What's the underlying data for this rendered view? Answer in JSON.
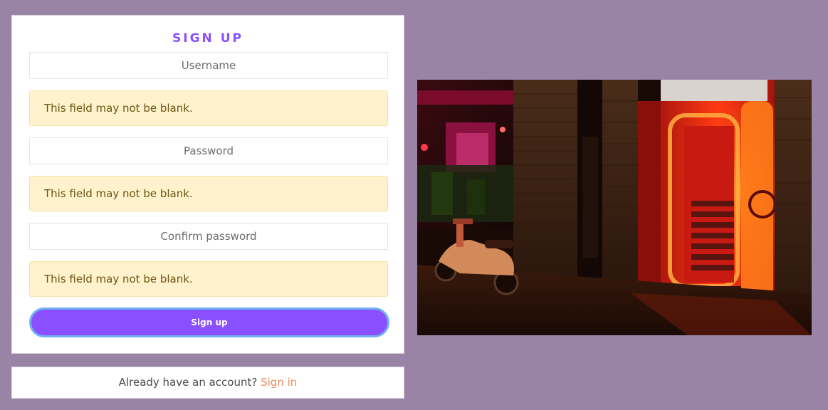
{
  "signup_form": {
    "title": "SIGN UP",
    "username_placeholder": "Username",
    "password_placeholder": "Password",
    "confirm_password_placeholder": "Confirm password",
    "username_error": "This field may not be blank.",
    "password_error": "This field may not be blank.",
    "confirm_password_error": "This field may not be blank.",
    "submit_label": "Sign up"
  },
  "signin_prompt": {
    "text": "Already have an account?",
    "link_label": "Sign in"
  },
  "photo": {
    "description": "Night street scene with a scooter parked beside a glowing red-lit doorway and stairway"
  },
  "colors": {
    "page_background": "#9a84a6",
    "accent_purple": "#8a4fff",
    "button_border": "#6fb0f2",
    "link_orange": "#f08a5d",
    "warning_background": "#fff2cc",
    "warning_text": "#6b5312"
  }
}
